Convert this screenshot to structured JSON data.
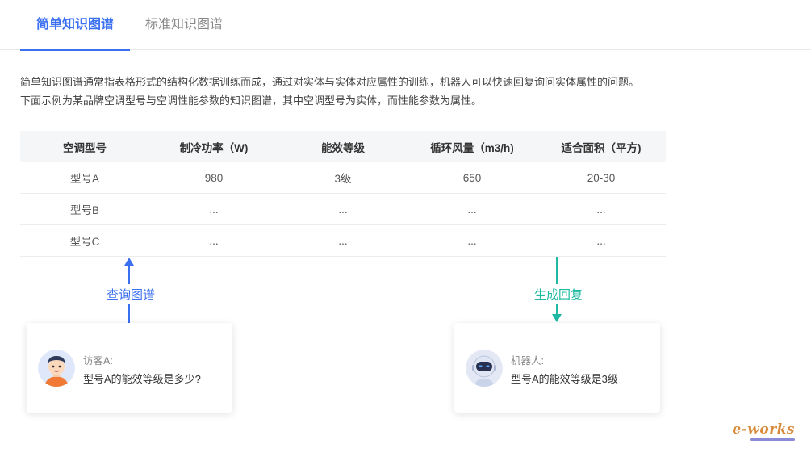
{
  "tabs": [
    {
      "label": "简单知识图谱",
      "active": true
    },
    {
      "label": "标准知识图谱",
      "active": false
    }
  ],
  "description": {
    "line1": "简单知识图谱通常指表格形式的结构化数据训练而成，通过对实体与实体对应属性的训练，机器人可以快速回复询问实体属性的问题。",
    "line2": "下面示例为某品牌空调型号与空调性能参数的知识图谱，其中空调型号为实体，而性能参数为属性。"
  },
  "table": {
    "headers": [
      "空调型号",
      "制冷功率（W)",
      "能效等级",
      "循环风量（m3/h)",
      "适合面积（平方)"
    ],
    "rows": [
      [
        "型号A",
        "980",
        "3级",
        "650",
        "20-30"
      ],
      [
        "型号B",
        "...",
        "...",
        "...",
        "..."
      ],
      [
        "型号C",
        "...",
        "...",
        "...",
        "..."
      ]
    ]
  },
  "flow": {
    "query_label": "查询图谱",
    "reply_label": "生成回复"
  },
  "visitor_card": {
    "speaker": "访客A:",
    "message": "型号A的能效等级是多少?"
  },
  "robot_card": {
    "speaker": "机器人:",
    "message": "型号A的能效等级是3级"
  },
  "colors": {
    "accent_blue": "#3a6ff0",
    "accent_teal": "#1fb8a0"
  },
  "watermark": "e-works"
}
